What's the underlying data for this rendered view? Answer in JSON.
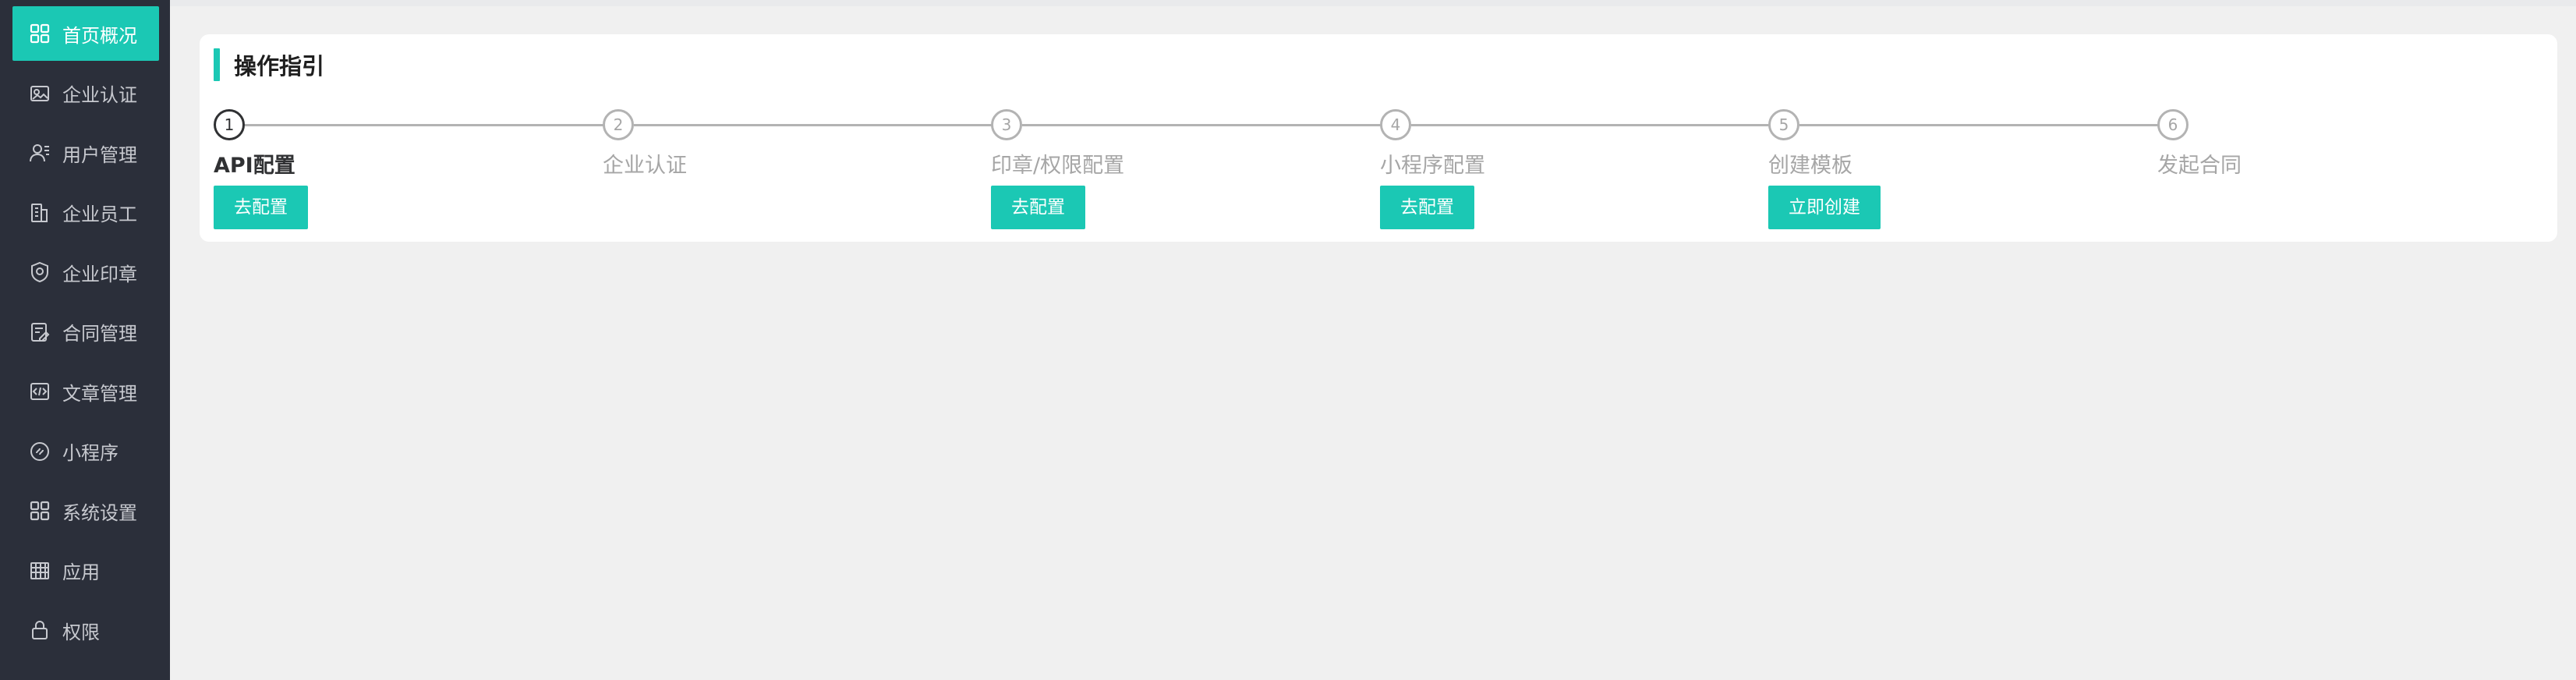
{
  "sidebar": {
    "items": [
      {
        "label": "首页概况",
        "icon": "dashboard-icon",
        "active": true
      },
      {
        "label": "企业认证",
        "icon": "certificate-icon",
        "active": false
      },
      {
        "label": "用户管理",
        "icon": "user-manage-icon",
        "active": false
      },
      {
        "label": "企业员工",
        "icon": "employee-icon",
        "active": false
      },
      {
        "label": "企业印章",
        "icon": "seal-icon",
        "active": false
      },
      {
        "label": "合同管理",
        "icon": "contract-icon",
        "active": false
      },
      {
        "label": "文章管理",
        "icon": "article-icon",
        "active": false
      },
      {
        "label": "小程序",
        "icon": "mini-program-icon",
        "active": false
      },
      {
        "label": "系统设置",
        "icon": "settings-grid-icon",
        "active": false
      },
      {
        "label": "应用",
        "icon": "apps-icon",
        "active": false
      },
      {
        "label": "权限",
        "icon": "lock-icon",
        "active": false
      }
    ]
  },
  "guide": {
    "title": "操作指引",
    "steps": [
      {
        "number": "1",
        "title": "API配置",
        "button": "去配置"
      },
      {
        "number": "2",
        "title": "企业认证",
        "button": ""
      },
      {
        "number": "3",
        "title": "印章/权限配置",
        "button": "去配置"
      },
      {
        "number": "4",
        "title": "小程序配置",
        "button": "去配置"
      },
      {
        "number": "5",
        "title": "创建模板",
        "button": "立即创建"
      },
      {
        "number": "6",
        "title": "发起合同",
        "button": ""
      }
    ]
  },
  "colors": {
    "accent": "#1bc8b4",
    "sidebar_bg": "#2b2f3a",
    "page_bg": "#f0f0f0",
    "step_active": "#303133",
    "step_inactive": "#a6a6a6"
  }
}
